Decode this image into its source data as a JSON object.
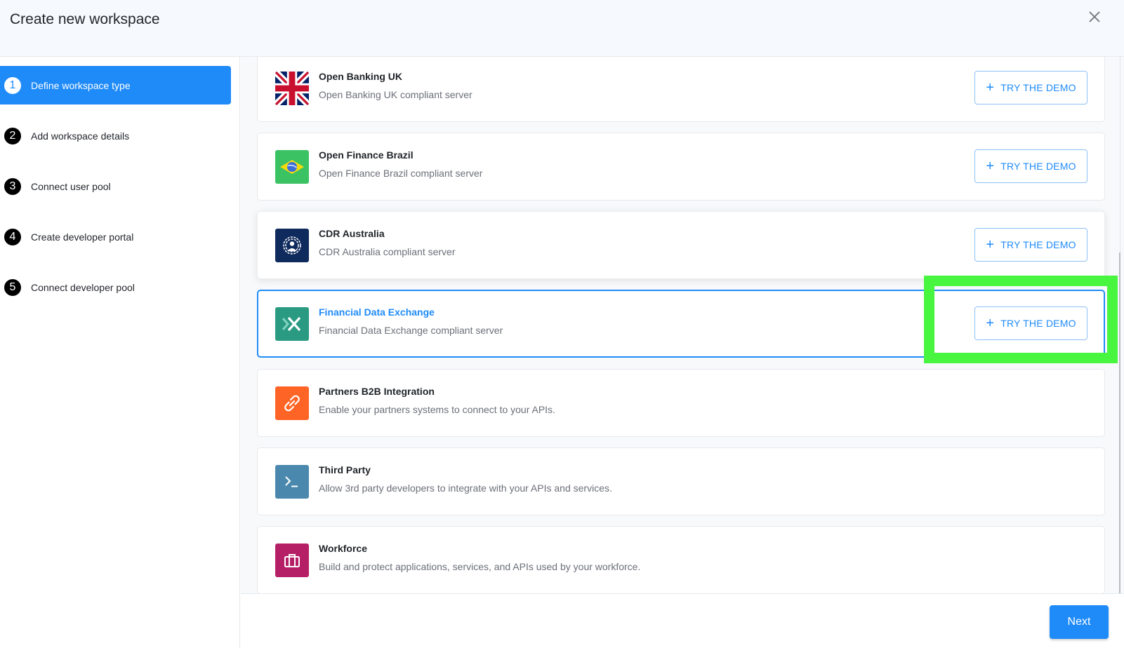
{
  "header": {
    "title": "Create new workspace",
    "close_icon": "close-icon"
  },
  "steps": [
    {
      "number": "1",
      "label": "Define workspace type",
      "active": true
    },
    {
      "number": "2",
      "label": "Add workspace details",
      "active": false
    },
    {
      "number": "3",
      "label": "Connect user pool",
      "active": false
    },
    {
      "number": "4",
      "label": "Create developer portal",
      "active": false
    },
    {
      "number": "5",
      "label": "Connect developer pool",
      "active": false
    }
  ],
  "workspace_types": [
    {
      "title": "Open Banking UK",
      "description": "Open Banking UK compliant server",
      "icon": "uk-flag-icon",
      "demo_label": "TRY THE DEMO",
      "has_demo": true,
      "selected": false
    },
    {
      "title": "Open Finance Brazil",
      "description": "Open Finance Brazil compliant server",
      "icon": "brazil-flag-icon",
      "icon_color": "#3ac263",
      "demo_label": "TRY THE DEMO",
      "has_demo": true,
      "selected": false
    },
    {
      "title": "CDR Australia",
      "description": "CDR Australia compliant server",
      "icon": "cdr-logo-icon",
      "icon_color": "#0f2a5c",
      "demo_label": "TRY THE DEMO",
      "has_demo": true,
      "selected": false
    },
    {
      "title": "Financial Data Exchange",
      "description": "Financial Data Exchange compliant server",
      "icon": "fdx-logo-icon",
      "icon_color": "#2a9a82",
      "demo_label": "TRY THE DEMO",
      "has_demo": true,
      "selected": true
    },
    {
      "title": "Partners B2B Integration",
      "description": "Enable your partners systems to connect to your APIs.",
      "icon": "link-icon",
      "icon_color": "#fd6425",
      "has_demo": false,
      "selected": false
    },
    {
      "title": "Third Party",
      "description": "Allow 3rd party developers to integrate with your APIs and services.",
      "icon": "terminal-icon",
      "icon_color": "#4a89ad",
      "has_demo": false,
      "selected": false
    },
    {
      "title": "Workforce",
      "description": "Build and protect applications, services, and APIs used by your workforce.",
      "icon": "briefcase-icon",
      "icon_color": "#b51f66",
      "has_demo": false,
      "selected": false
    }
  ],
  "footer": {
    "next_label": "Next"
  },
  "colors": {
    "accent": "#1f8bf9",
    "highlight": "#48f53f"
  }
}
